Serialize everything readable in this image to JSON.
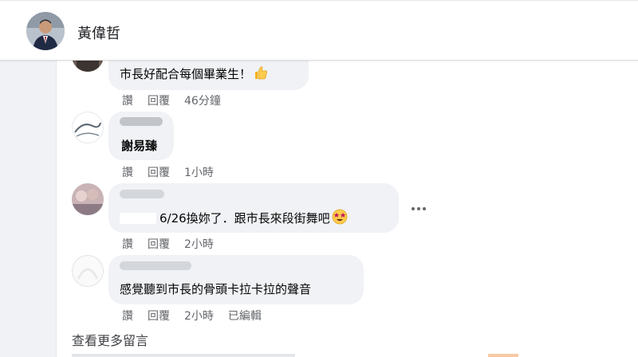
{
  "header": {
    "page_name": "黃偉哲"
  },
  "comments": [
    {
      "text": "市長好配合每個畢業生！",
      "emoji": "thumbs-up-icon",
      "actions": {
        "like": "讚",
        "reply": "回覆",
        "time": "46分鐘"
      }
    },
    {
      "text": "謝易臻",
      "actions": {
        "like": "讚",
        "reply": "回覆",
        "time": "1小時"
      }
    },
    {
      "text": "6/26換妳了．跟市長來段街舞吧",
      "emoji": "star-struck-icon",
      "actions": {
        "like": "讚",
        "reply": "回覆",
        "time": "2小時"
      }
    },
    {
      "text": "感覺聽到市長的骨頭卡拉卡拉的聲音",
      "actions": {
        "like": "讚",
        "reply": "回覆",
        "time": "2小時",
        "edited": "已編輯"
      }
    }
  ],
  "view_more": "查看更多留言",
  "colors": {
    "page_bg": "#f0f2f5",
    "bubble": "#f0f2f5",
    "secondary_text": "#65676b",
    "primary_text": "#050505"
  }
}
